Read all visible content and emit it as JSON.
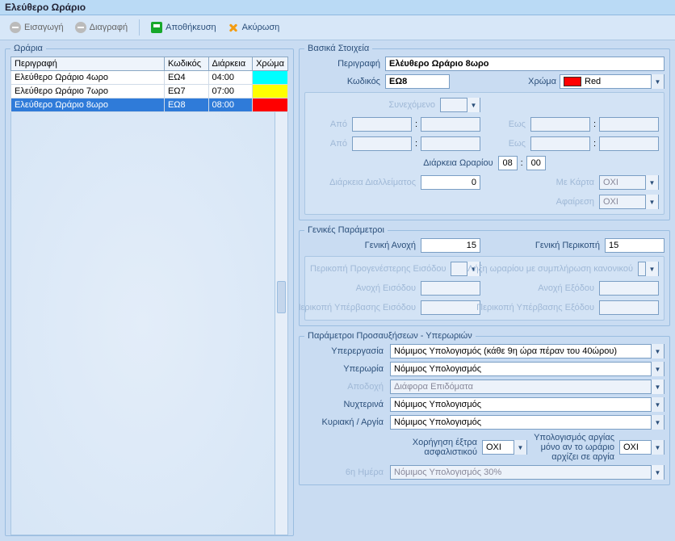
{
  "title": "Ελεύθερο Ωράριο",
  "toolbar": {
    "insert": "Εισαγωγή",
    "delete": "Διαγραφή",
    "save": "Αποθήκευση",
    "cancel": "Ακύρωση"
  },
  "grid": {
    "legend": "Ωράρια",
    "headers": {
      "desc": "Περιγραφή",
      "code": "Κωδικός",
      "dur": "Διάρκεια",
      "color": "Χρώμα"
    },
    "rows": [
      {
        "desc": "Ελεύθερο Ωράριο 4ωρο",
        "code": "ΕΩ4",
        "dur": "04:00",
        "color": "#00ffff"
      },
      {
        "desc": "Ελεύθερο Ωράριο 7ωρο",
        "code": "ΕΩ7",
        "dur": "07:00",
        "color": "#ffff00"
      },
      {
        "desc": "Ελεύθερο Ωράριο 8ωρο",
        "code": "ΕΩ8",
        "dur": "08:00",
        "color": "#ff0000"
      }
    ],
    "selected_index": 2
  },
  "basic": {
    "legend": "Βασικά Στοιχεία",
    "labels": {
      "desc": "Περιγραφή",
      "code": "Κωδικός",
      "color": "Χρώμα",
      "continuous": "Συνεχόμενο",
      "from": "Από",
      "to": "Εως",
      "duration": "Διάρκεια Ωραρίου",
      "breakdur": "Διάρκεια Διαλλείματος",
      "card": "Με Κάρτα",
      "subtract": "Αφαίρεση"
    },
    "values": {
      "desc": "Ελέυθερο Ωράριο 8ωρο",
      "code": "ΕΩ8",
      "color_name": "Red",
      "color_hex": "#ff0000",
      "dur_h": "08",
      "dur_m": "00",
      "break": "0",
      "card": "ΟΧΙ",
      "subtract": "ΟΧΙ"
    }
  },
  "general": {
    "legend": "Γενικές Παράμετροι",
    "labels": {
      "tolerance": "Γενική Ανοχή",
      "cut": "Γενική Περικοπή",
      "earlyin_cut": "Περικοπή Προγενέστερης Εισόδου",
      "schedule_end": "Λήξη ωραρίου με συμπλήρωση κανονικού",
      "in_tol": "Ανοχή Εισόδου",
      "out_tol": "Ανοχή Εξόδου",
      "overin_cut": "Περικοπή Υπέρβασης Εισόδου",
      "overout_cut": "Περικοπή Υπέρβασης Εξόδου"
    },
    "values": {
      "tolerance": "15",
      "cut": "15"
    }
  },
  "overtime": {
    "legend": "Παράμετροι Προσαυξήσεων - Υπερωριών",
    "labels": {
      "yperergasia": "Υπερεργασία",
      "yperoria": "Υπερωρία",
      "apodoxi": "Αποδοχή",
      "nyxterina": "Νυχτερινά",
      "kyriaki": "Κυριακή / Αργία",
      "xorigisi": "Χορήγηση έξτρα ασφαλιστικού",
      "ypologismos_argias": "Υπολογισμός αργίας μόνο αν το ωράριο αρχίζει σε αργία",
      "day6": "6η Ημέρα"
    },
    "values": {
      "yperergasia": "Νόμιμος Υπολογισμός (κάθε 9η ώρα πέραν του 40ώρου)",
      "yperoria": "Νόμιμος Υπολογισμός",
      "apodoxi": "Διάφορα Επιδόματα",
      "nyxterina": "Νόμιμος Υπολογισμός",
      "kyriaki": "Νόμιμος Υπολογισμός",
      "xorigisi": "ΟΧΙ",
      "ypologismos_argias": "ΟΧΙ",
      "day6": "Νόμιμος Υπολογισμός 30%"
    }
  }
}
